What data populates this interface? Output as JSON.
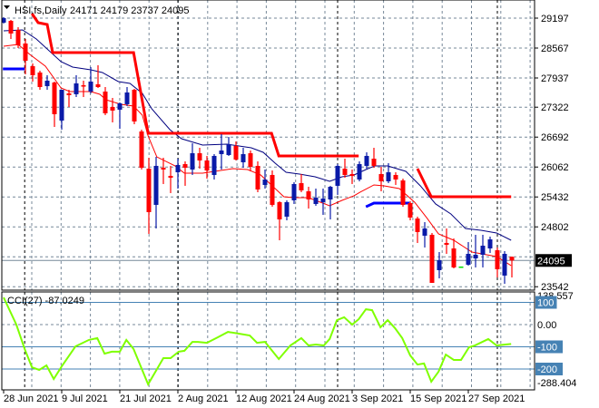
{
  "chart_data": {
    "type": "candlestick",
    "title": "HSI.fs,Daily",
    "ohlc_header": "24171 24179 23737 24095",
    "colors": {
      "bull": "#0a1aa8",
      "bear": "#ff0000",
      "doji": "#00dd00",
      "ma_fast": "#ff0000",
      "ma_slow": "#000080",
      "stop_red": "#ff0000",
      "stop_blue": "#0000ff",
      "cci": "#7fff00",
      "level": "#4682b4"
    },
    "price_range": [
      23527,
      29197
    ],
    "y_ticks": [
      "29197",
      "28567",
      "27937",
      "27322",
      "26692",
      "26062",
      "25432",
      "24802",
      "23542"
    ],
    "grid_prices": [
      29197,
      28567,
      27937,
      27322,
      26692,
      26062,
      25432,
      24802,
      24172,
      23542
    ],
    "current_price": "24095",
    "current_price_value": 24095,
    "x_labels": [
      {
        "bar": 0,
        "label": "28 Jun 2021"
      },
      {
        "bar": 8,
        "label": "9 Jul 2021"
      },
      {
        "bar": 16,
        "label": "21 Jul 2021"
      },
      {
        "bar": 24,
        "label": "2 Aug 2021"
      },
      {
        "bar": 32,
        "label": "12 Aug 2021"
      },
      {
        "bar": 40,
        "label": "24 Aug 2021"
      },
      {
        "bar": 48,
        "label": "3 Sep 2021"
      },
      {
        "bar": 56,
        "label": "15 Sep 2021"
      },
      {
        "bar": 64,
        "label": "27 Sep 2021"
      }
    ],
    "month_separators": [
      2.9,
      24,
      46,
      68
    ],
    "candles_ohlc": [
      [
        29102,
        29216,
        29083,
        29197
      ],
      [
        29140,
        29159,
        28758,
        28873
      ],
      [
        28949,
        29006,
        28567,
        28625
      ],
      [
        28663,
        28758,
        28014,
        28300
      ],
      [
        28185,
        28243,
        27861,
        27995
      ],
      [
        28052,
        28090,
        27689,
        27746
      ],
      [
        27765,
        27995,
        27689,
        27880
      ],
      [
        27842,
        27861,
        26906,
        27174
      ],
      [
        27040,
        27689,
        26849,
        27689
      ],
      [
        27613,
        27689,
        27326,
        27575
      ],
      [
        27594,
        27995,
        27536,
        27823
      ],
      [
        27784,
        27880,
        27536,
        27765
      ],
      [
        27651,
        28166,
        27613,
        27861
      ],
      [
        27804,
        28205,
        27727,
        27746
      ],
      [
        27651,
        27746,
        27155,
        27193
      ],
      [
        27326,
        27517,
        27002,
        27250
      ],
      [
        27269,
        27422,
        26868,
        27403
      ],
      [
        27384,
        27746,
        27346,
        27632
      ],
      [
        27689,
        27708,
        26964,
        27021
      ],
      [
        26811,
        26849,
        26009,
        26047
      ],
      [
        26028,
        26257,
        24654,
        25112
      ],
      [
        25265,
        26276,
        24768,
        26086
      ],
      [
        26047,
        26257,
        25704,
        26009
      ],
      [
        25876,
        26086,
        25513,
        25837
      ],
      [
        25952,
        26238,
        25608,
        26105
      ],
      [
        26124,
        26181,
        25666,
        26047
      ],
      [
        26009,
        26563,
        25895,
        26353
      ],
      [
        26353,
        26467,
        26028,
        26200
      ],
      [
        26200,
        26296,
        25818,
        25990
      ],
      [
        25895,
        26334,
        25799,
        26296
      ],
      [
        26334,
        26754,
        26009,
        26410
      ],
      [
        26315,
        26696,
        26296,
        26544
      ],
      [
        26506,
        26601,
        26200,
        26219
      ],
      [
        26162,
        26467,
        26047,
        26334
      ],
      [
        26353,
        26410,
        25971,
        26066
      ],
      [
        26086,
        26181,
        25532,
        25589
      ],
      [
        25685,
        26009,
        25608,
        25799
      ],
      [
        25895,
        25990,
        25227,
        25265
      ],
      [
        25322,
        25341,
        24520,
        24959
      ],
      [
        25017,
        25360,
        24940,
        25322
      ],
      [
        25360,
        25742,
        25284,
        25704
      ],
      [
        25723,
        25914,
        25532,
        25570
      ],
      [
        25551,
        25646,
        25188,
        25379
      ],
      [
        25284,
        25608,
        25246,
        25417
      ],
      [
        25322,
        25608,
        25055,
        25398
      ],
      [
        25379,
        25666,
        24959,
        25646
      ],
      [
        25666,
        26124,
        25475,
        26086
      ],
      [
        26028,
        26238,
        25837,
        25895
      ],
      [
        25914,
        26009,
        25704,
        25876
      ],
      [
        25799,
        26181,
        25761,
        26124
      ],
      [
        26086,
        26372,
        26028,
        26296
      ],
      [
        26238,
        26467,
        26047,
        26086
      ],
      [
        25914,
        26066,
        25551,
        25761
      ],
      [
        25761,
        26143,
        25723,
        25952
      ],
      [
        25895,
        25952,
        25685,
        25799
      ],
      [
        25780,
        25818,
        25227,
        25265
      ],
      [
        25303,
        25341,
        24940,
        24998
      ],
      [
        24978,
        25017,
        24463,
        24693
      ],
      [
        24616,
        24902,
        24368,
        24769
      ],
      [
        24635,
        24673,
        23623,
        23623
      ],
      [
        23890,
        24272,
        23718,
        24100
      ],
      [
        24463,
        24768,
        24234,
        24425
      ],
      [
        24348,
        24558,
        23928,
        23948
      ],
      [
        23967,
        23967,
        23967,
        23967
      ],
      [
        24005,
        24482,
        23986,
        24234
      ],
      [
        24138,
        24635,
        23948,
        24215
      ],
      [
        24215,
        24635,
        23948,
        24406
      ],
      [
        24348,
        24597,
        24253,
        24539
      ],
      [
        24310,
        24367,
        23737,
        23909
      ],
      [
        23776,
        24291,
        23604,
        24234
      ],
      [
        24171,
        24179,
        23737,
        24095
      ]
    ],
    "ma_slow": [
      [
        0,
        28930
      ],
      [
        2.6,
        28949
      ],
      [
        4.5,
        28758
      ],
      [
        7.9,
        28281
      ],
      [
        9.5,
        28166
      ],
      [
        12,
        28109
      ],
      [
        13.6,
        28052
      ],
      [
        15.8,
        27861
      ],
      [
        17.4,
        27823
      ],
      [
        19.1,
        27613
      ],
      [
        20.4,
        27288
      ],
      [
        22.9,
        26849
      ],
      [
        24.5,
        26658
      ],
      [
        27.4,
        26525
      ],
      [
        30.75,
        26544
      ],
      [
        34.1,
        26467
      ],
      [
        35.75,
        26372
      ],
      [
        37.4,
        26143
      ],
      [
        38.9,
        25952
      ],
      [
        40.75,
        25914
      ],
      [
        42.9,
        25856
      ],
      [
        44.9,
        25761
      ],
      [
        46.6,
        25856
      ],
      [
        48.25,
        25895
      ],
      [
        49.9,
        26009
      ],
      [
        51.1,
        26086
      ],
      [
        52.9,
        26086
      ],
      [
        55.4,
        25971
      ],
      [
        57.4,
        25666
      ],
      [
        59.5,
        25284
      ],
      [
        61.6,
        25074
      ],
      [
        63.6,
        24768
      ],
      [
        65.75,
        24730
      ],
      [
        67.9,
        24673
      ],
      [
        69.9,
        24520
      ]
    ],
    "ma_fast": [
      [
        0,
        28605
      ],
      [
        2,
        28644
      ],
      [
        3.6,
        28434
      ],
      [
        5.75,
        28185
      ],
      [
        7.9,
        27727
      ],
      [
        9.1,
        27651
      ],
      [
        12,
        27651
      ],
      [
        13.25,
        27594
      ],
      [
        14.1,
        27479
      ],
      [
        16.1,
        27384
      ],
      [
        17.9,
        27346
      ],
      [
        19.1,
        27155
      ],
      [
        19.9,
        26716
      ],
      [
        21.1,
        26276
      ],
      [
        23.6,
        26086
      ],
      [
        24.9,
        25933
      ],
      [
        27.4,
        25933
      ],
      [
        31.6,
        26028
      ],
      [
        33.6,
        26009
      ],
      [
        35.4,
        25895
      ],
      [
        37,
        25666
      ],
      [
        38.6,
        25436
      ],
      [
        39.9,
        25417
      ],
      [
        42,
        25417
      ],
      [
        44.9,
        25246
      ],
      [
        46.6,
        25360
      ],
      [
        48.25,
        25456
      ],
      [
        49.1,
        25532
      ],
      [
        51,
        25685
      ],
      [
        52.4,
        25666
      ],
      [
        54.5,
        25608
      ],
      [
        56.6,
        25322
      ],
      [
        58.25,
        24998
      ],
      [
        59.9,
        24654
      ],
      [
        62,
        24520
      ],
      [
        64.5,
        24272
      ],
      [
        67.9,
        24176
      ],
      [
        69.9,
        23986
      ]
    ],
    "stop_red": [
      [
        [
          3.9,
          29293
        ],
        [
          4.75,
          29102
        ],
        [
          6,
          29063
        ],
        [
          6.75,
          28472
        ],
        [
          17.9,
          28472
        ],
        [
          19.9,
          26773
        ],
        [
          36.9,
          26773
        ],
        [
          37.9,
          26296
        ],
        [
          48.9,
          26296
        ]
      ],
      [
        [
          57,
          26028
        ],
        [
          58.9,
          25436
        ],
        [
          69.9,
          25436
        ]
      ]
    ],
    "stop_blue": [
      [
        [
          -0.1,
          28128
        ],
        [
          2.9,
          28128
        ]
      ],
      [
        [
          49.9,
          25225
        ],
        [
          51,
          25303
        ],
        [
          55.9,
          25303
        ]
      ]
    ],
    "cci": {
      "label": "CCI(27) -87.0249",
      "range": [
        -288.404,
        138.557
      ],
      "max_label": "138.557",
      "min_label": "-288.404",
      "zero_label": "0.00",
      "levels": [
        {
          "value": 100,
          "label": "100"
        },
        {
          "value": -100,
          "label": "-100"
        },
        {
          "value": -200,
          "label": "-200"
        }
      ],
      "points": [
        [
          0,
          122
        ],
        [
          1.75,
          0
        ],
        [
          2.9,
          -110
        ],
        [
          3.9,
          -192
        ],
        [
          4.9,
          -204
        ],
        [
          5.9,
          -184
        ],
        [
          6.9,
          -245
        ],
        [
          8,
          -188
        ],
        [
          9.9,
          -98
        ],
        [
          11.75,
          -69
        ],
        [
          12.9,
          -61
        ],
        [
          13.9,
          -131
        ],
        [
          14.9,
          -122
        ],
        [
          16,
          -122
        ],
        [
          16.9,
          -69
        ],
        [
          17.9,
          -110
        ],
        [
          19.9,
          -269
        ],
        [
          22,
          -151
        ],
        [
          23,
          -151
        ],
        [
          24.1,
          -122
        ],
        [
          24.9,
          -118
        ],
        [
          26,
          -78
        ],
        [
          26.75,
          -78
        ],
        [
          28,
          -82
        ],
        [
          29.5,
          -57
        ],
        [
          30.9,
          -33
        ],
        [
          32.4,
          -41
        ],
        [
          33.9,
          -49
        ],
        [
          34.9,
          -82
        ],
        [
          36,
          -78
        ],
        [
          37.9,
          -155
        ],
        [
          39.5,
          -94
        ],
        [
          41,
          -61
        ],
        [
          42,
          -94
        ],
        [
          43,
          -90
        ],
        [
          44.1,
          -94
        ],
        [
          44.9,
          -65
        ],
        [
          45.9,
          20
        ],
        [
          46.9,
          33
        ],
        [
          48,
          0
        ],
        [
          48.9,
          24
        ],
        [
          49.9,
          69
        ],
        [
          50.75,
          65
        ],
        [
          51.9,
          -12
        ],
        [
          52.9,
          20
        ],
        [
          53.9,
          -16
        ],
        [
          54.9,
          -61
        ],
        [
          56,
          -139
        ],
        [
          57,
          -180
        ],
        [
          57.9,
          -175
        ],
        [
          58.9,
          -257
        ],
        [
          59.9,
          -212
        ],
        [
          60.9,
          -135
        ],
        [
          62,
          -159
        ],
        [
          63,
          -159
        ],
        [
          64.1,
          -102
        ],
        [
          64.9,
          -94
        ],
        [
          66.75,
          -65
        ],
        [
          67.9,
          -94
        ],
        [
          69.1,
          -90
        ],
        [
          69.9,
          -87.0249
        ]
      ]
    }
  }
}
